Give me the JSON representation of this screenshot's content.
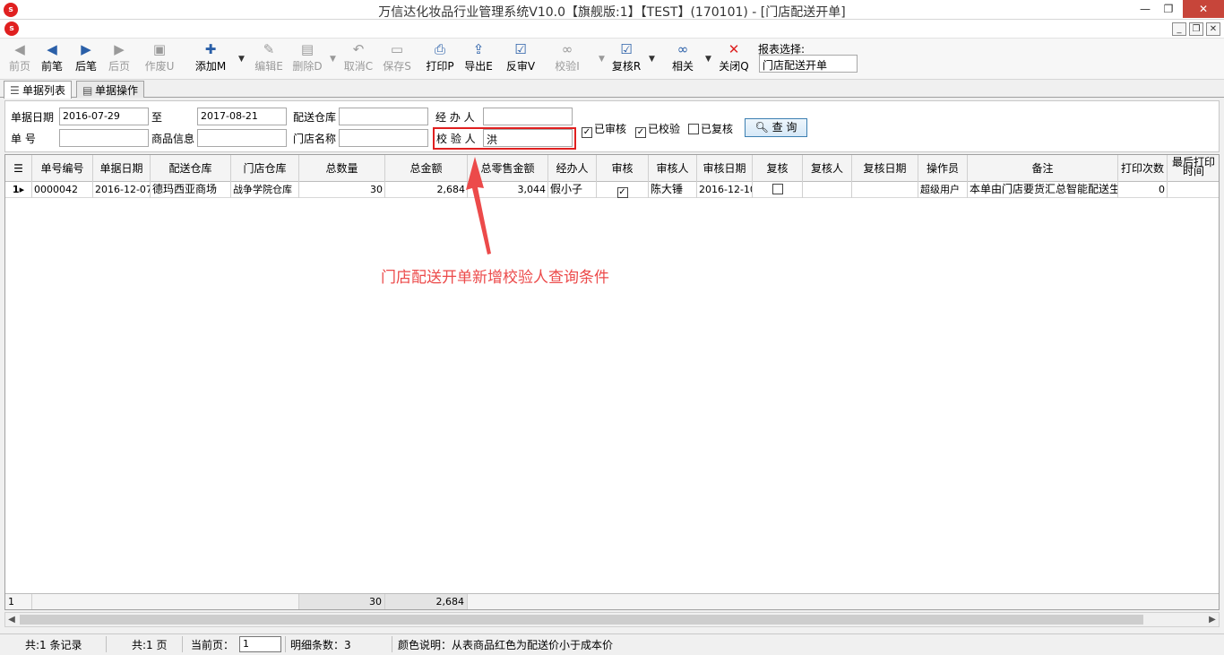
{
  "window": {
    "title": "万信达化妆品行业管理系统V10.0【旗舰版:1】【TEST】(170101) - [门店配送开单]",
    "logo": "logo-icon"
  },
  "toolbar": {
    "buttons": [
      {
        "label": "前页",
        "icon": "first-page-icon",
        "enabled": false
      },
      {
        "label": "前笔",
        "icon": "prev-record-icon",
        "enabled": true
      },
      {
        "label": "后笔",
        "icon": "next-record-icon",
        "enabled": true
      },
      {
        "label": "后页",
        "icon": "last-page-icon",
        "enabled": false
      },
      {
        "label": "作废U",
        "icon": "void-icon",
        "enabled": false
      },
      {
        "label": "添加M",
        "icon": "add-icon",
        "enabled": true
      },
      {
        "label": "编辑E",
        "icon": "edit-icon",
        "enabled": false
      },
      {
        "label": "删除D",
        "icon": "delete-icon",
        "enabled": false
      },
      {
        "label": "取消C",
        "icon": "undo-icon",
        "enabled": false
      },
      {
        "label": "保存S",
        "icon": "save-icon",
        "enabled": false
      },
      {
        "label": "打印P",
        "icon": "print-icon",
        "enabled": true
      },
      {
        "label": "导出E",
        "icon": "export-icon",
        "enabled": true
      },
      {
        "label": "反审V",
        "icon": "unapprove-icon",
        "enabled": true
      },
      {
        "label": "校验I",
        "icon": "verify-link-icon",
        "enabled": false
      },
      {
        "label": "复核R",
        "icon": "recheck-icon",
        "enabled": true
      },
      {
        "label": "相关",
        "icon": "related-link-icon",
        "enabled": true
      },
      {
        "label": "关闭Q",
        "icon": "close-x-icon",
        "enabled": true
      }
    ],
    "report_select_caption": "报表选择:",
    "report_select_value": "门店配送开单"
  },
  "tabs": [
    {
      "label": "单据列表",
      "icon": "list-icon",
      "active": true
    },
    {
      "label": "单据操作",
      "icon": "form-icon",
      "active": false
    }
  ],
  "filters": {
    "date_label": "单据日期",
    "date_from": "2016-07-29",
    "date_to_label": "至",
    "date_to": "2017-08-21",
    "warehouse_label": "配送仓库",
    "warehouse_value": "",
    "handler_label": "经 办 人",
    "handler_value": "",
    "docno_label": "单        号",
    "docno_value": "",
    "goods_label": "商品信息",
    "goods_value": "",
    "store_label": "门店名称",
    "store_value": "",
    "verifier_label": "校 验 人",
    "verifier_value": "洪",
    "checks": [
      {
        "label": "已审核",
        "checked": true
      },
      {
        "label": "已校验",
        "checked": true
      },
      {
        "label": "已复核",
        "checked": false
      }
    ],
    "query_label": "查  询"
  },
  "table": {
    "columns": [
      "单号编号",
      "单据日期",
      "配送仓库",
      "门店仓库",
      "总数量",
      "总金额",
      "总零售金额",
      "经办人",
      "审核",
      "审核人",
      "审核日期",
      "复核",
      "复核人",
      "复核日期",
      "操作员",
      "备注",
      "打印次数",
      "最后打印时间"
    ],
    "rows": [
      {
        "indicator": "1",
        "cells": [
          "0000042",
          "2016-12-07",
          "德玛西亚商场",
          "战争学院仓库",
          "30",
          "2,684",
          "3,044",
          "假小子",
          "",
          "陈大锤",
          "2016-12-10",
          "",
          "",
          "",
          "超级用户",
          "本单由门店要货汇总智能配送生",
          "0",
          ""
        ],
        "approved": true,
        "rechecked": false
      }
    ],
    "footer": {
      "row_count": "1",
      "total_qty": "30",
      "total_amount": "2,684"
    }
  },
  "annotation": "门店配送开单新增校验人查询条件",
  "status": {
    "records": "共:1 条记录",
    "pages": "共:1 页",
    "current_page_label": "当前页：",
    "current_page": "1",
    "detail_count": "明细条数：3",
    "color_note": "颜色说明：从表商品红色为配送价小于成本价"
  },
  "colors": {
    "highlight": "#e02020",
    "annotation": "#ec4a4a",
    "close_button": "#c7453a"
  }
}
